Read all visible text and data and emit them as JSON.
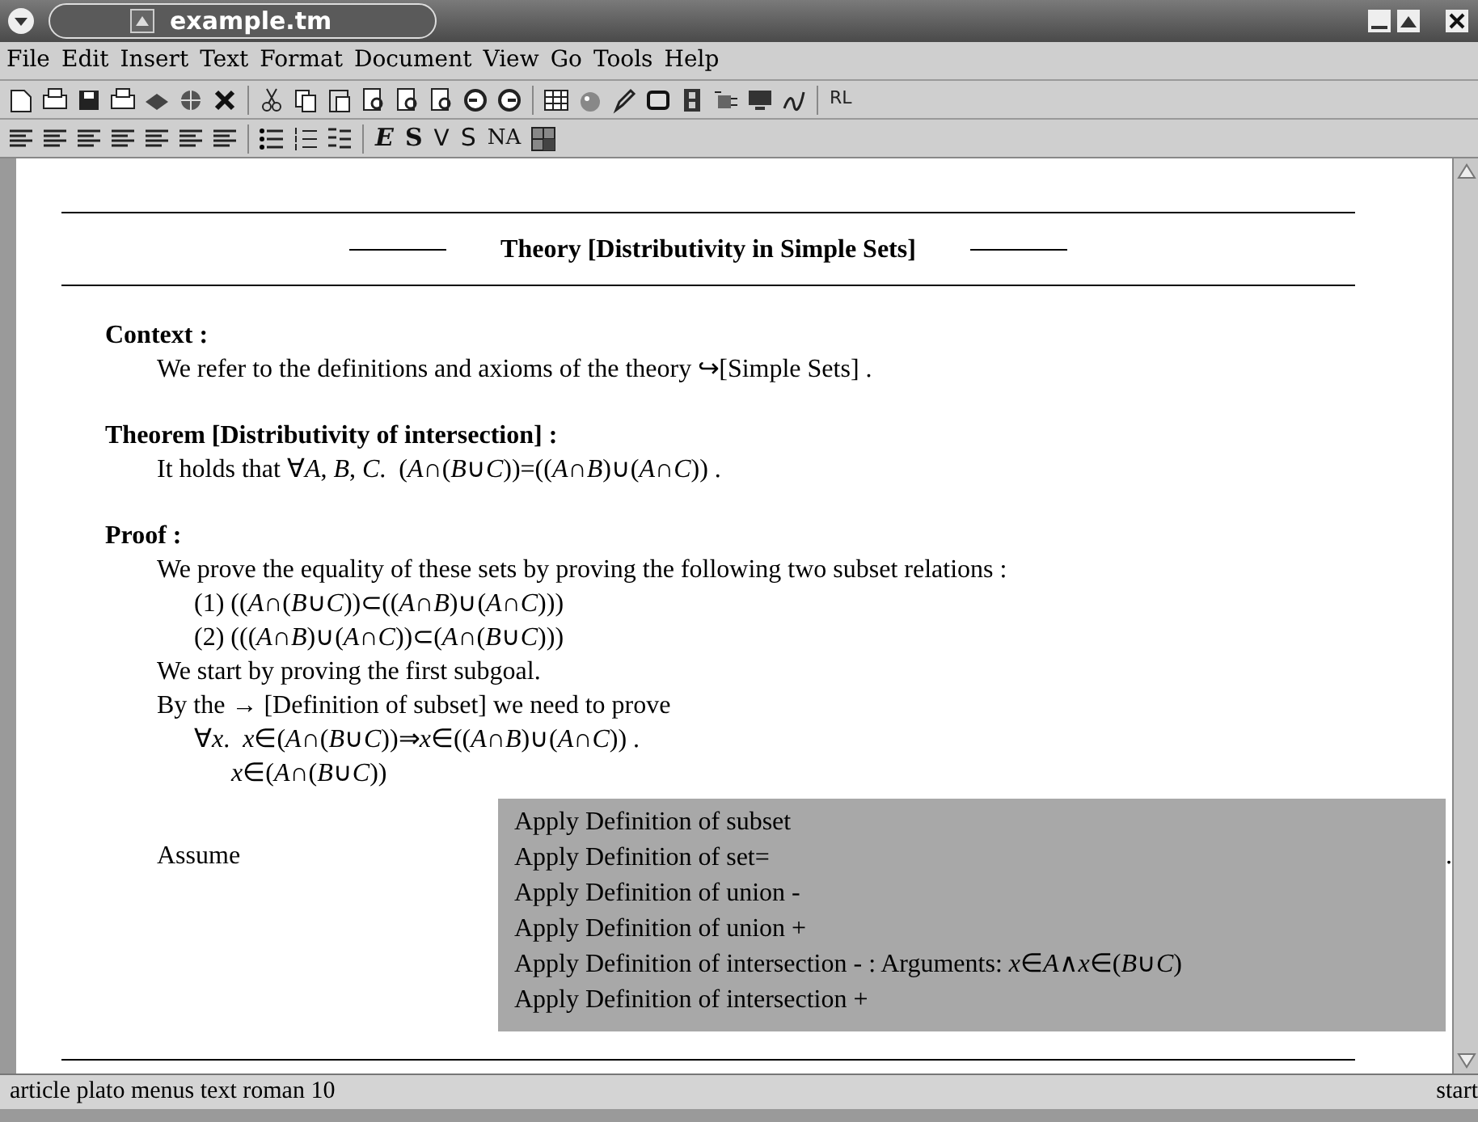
{
  "window": {
    "title": "example.tm"
  },
  "menu": [
    "File",
    "Edit",
    "Insert",
    "Text",
    "Format",
    "Document",
    "View",
    "Go",
    "Tools",
    "Help"
  ],
  "toolbar": {
    "text_button": "RL"
  },
  "format_buttons": [
    {
      "label": "E",
      "kind": "emphasis"
    },
    {
      "label": "S",
      "kind": "strong"
    },
    {
      "label": "V",
      "kind": "verbatim"
    },
    {
      "label": "S",
      "kind": "sans"
    },
    {
      "label": "NA",
      "kind": "name"
    }
  ],
  "document": {
    "title": "Theory [Distributivity in Simple Sets]",
    "sections": [
      {
        "heading": "Context :",
        "lines": [
          {
            "text": "We refer to the definitions and axioms of the theory ↪[Simple Sets] ."
          }
        ]
      },
      {
        "heading": "Theorem [Distributivity of intersection] :",
        "lines": [
          {
            "text": "It holds that ∀*A*, *B*, *C*.  (*A*∩(*B*∪*C*))=((*A*∩*B*)∪(*A*∩*C*)) ."
          }
        ]
      },
      {
        "heading": "Proof :",
        "lines": [
          {
            "text": "We prove the equality of these sets by proving the following two subset relations :",
            "children": [
              {
                "text": "(1) ((*A*∩(*B*∪*C*))⊂((*A*∩*B*)∪(*A*∩*C*)))"
              },
              {
                "text": "(2) (((*A*∩*B*)∪(*A*∩*C*))⊂(*A*∩(*B*∪*C*)))"
              }
            ]
          },
          {
            "text": "We start by proving the first subgoal."
          },
          {
            "text": "By the → [Definition of subset] we need to prove",
            "children": [
              {
                "text": "∀*x*.  *x*∈(*A*∩(*B*∪*C*))⇒*x*∈((*A*∩*B*)∪(*A*∩*C*)) .",
                "children": [
                  {
                    "text": "*x*∈(*A*∩(*B*∪*C*))"
                  }
                ]
              }
            ]
          },
          {
            "text": "Assume",
            "kind": "assume",
            "tail": "."
          }
        ]
      }
    ]
  },
  "popup": [
    "Apply Definition of subset",
    "Apply Definition of set=",
    "Apply Definition of union -",
    "Apply Definition of union +",
    "Apply Definition of intersection - : Arguments: *x*∈*A*∧*x*∈(*B*∪*C*)",
    "Apply Definition of intersection +"
  ],
  "status_bar": {
    "left": "article plato menus text roman 10",
    "right": "start"
  }
}
